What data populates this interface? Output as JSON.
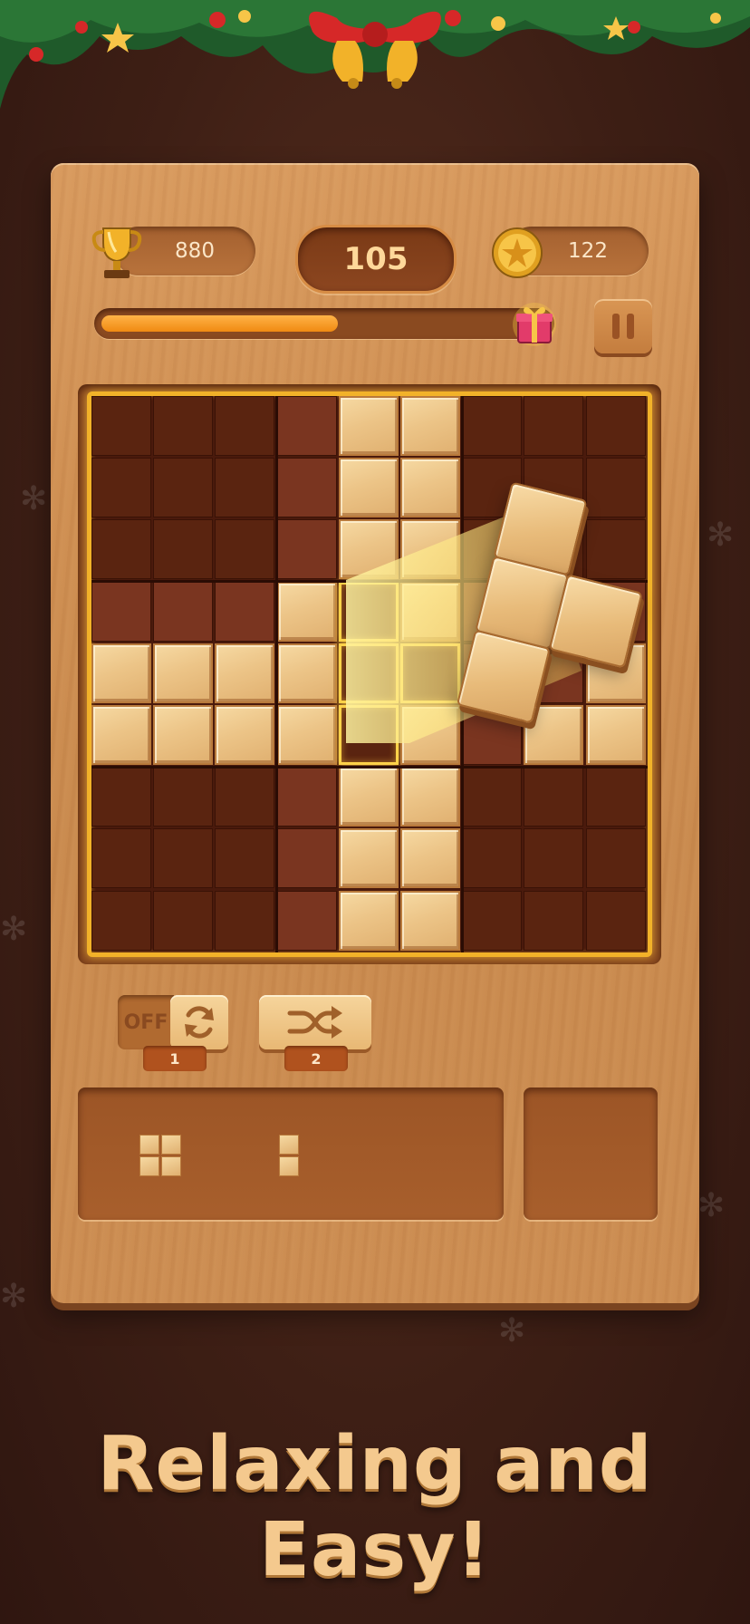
{
  "header": {
    "best_score": "880",
    "current_score": "105",
    "coins": "122",
    "progress_fraction": 0.53
  },
  "boosters": {
    "rotate_state": "OFF",
    "rotate_count": "1",
    "shuffle_count": "2"
  },
  "board": {
    "size": 9,
    "filled": [
      [
        0,
        4
      ],
      [
        0,
        5
      ],
      [
        1,
        4
      ],
      [
        1,
        5
      ],
      [
        2,
        4
      ],
      [
        2,
        5
      ],
      [
        3,
        3
      ],
      [
        3,
        5
      ],
      [
        4,
        0
      ],
      [
        4,
        1
      ],
      [
        4,
        2
      ],
      [
        4,
        3
      ],
      [
        4,
        8
      ],
      [
        5,
        0
      ],
      [
        5,
        1
      ],
      [
        5,
        2
      ],
      [
        5,
        3
      ],
      [
        5,
        5
      ],
      [
        5,
        7
      ],
      [
        5,
        8
      ],
      [
        6,
        4
      ],
      [
        6,
        5
      ],
      [
        7,
        4
      ],
      [
        7,
        5
      ],
      [
        8,
        4
      ],
      [
        8,
        5
      ]
    ],
    "highlighted": [
      [
        3,
        4
      ],
      [
        4,
        4
      ],
      [
        4,
        5
      ],
      [
        5,
        4
      ]
    ]
  },
  "colors": {
    "accent_gold": "#f2b229",
    "board_wood": "#cf8f52",
    "background": "#3e1f15"
  },
  "tagline": "Relaxing and Easy!"
}
